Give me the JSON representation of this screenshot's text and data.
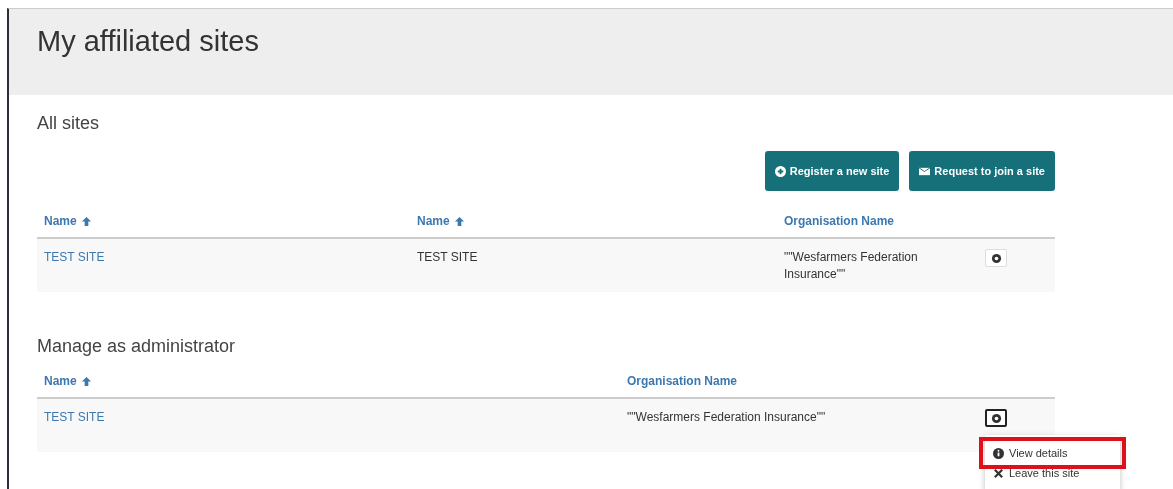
{
  "page": {
    "title": "My affiliated sites"
  },
  "sections": [
    {
      "heading": "All sites",
      "actions": [
        {
          "label": "Register a new site",
          "kind": "add"
        },
        {
          "label": "Request to join a site",
          "kind": "mail"
        }
      ],
      "columns": [
        {
          "label": "Name",
          "sorted": true
        },
        {
          "label": "Name",
          "sorted": true
        },
        {
          "label": "Organisation Name",
          "sorted": false
        }
      ],
      "rows": [
        {
          "cells": [
            {
              "text": "TEST SITE",
              "kind": "link"
            },
            {
              "text": "TEST SITE",
              "kind": "plain"
            },
            {
              "text": "\"\"Wesfarmers Federation Insurance\"\"",
              "kind": "plain"
            }
          ],
          "menu_open": false
        }
      ]
    },
    {
      "heading": "Manage as administrator",
      "columns": [
        {
          "label": "Name",
          "sorted": true
        },
        {
          "label": "Organisation Name",
          "sorted": false
        }
      ],
      "rows": [
        {
          "cells": [
            {
              "text": "TEST SITE",
              "kind": "link"
            },
            {
              "text": "\"\"Wesfarmers Federation Insurance\"\"",
              "kind": "plain"
            }
          ],
          "menu_open": true,
          "menu": [
            {
              "label": "View details",
              "kind": "info",
              "highlighted": true
            },
            {
              "label": "Leave this site",
              "kind": "remove",
              "highlighted": false
            }
          ]
        }
      ]
    }
  ]
}
